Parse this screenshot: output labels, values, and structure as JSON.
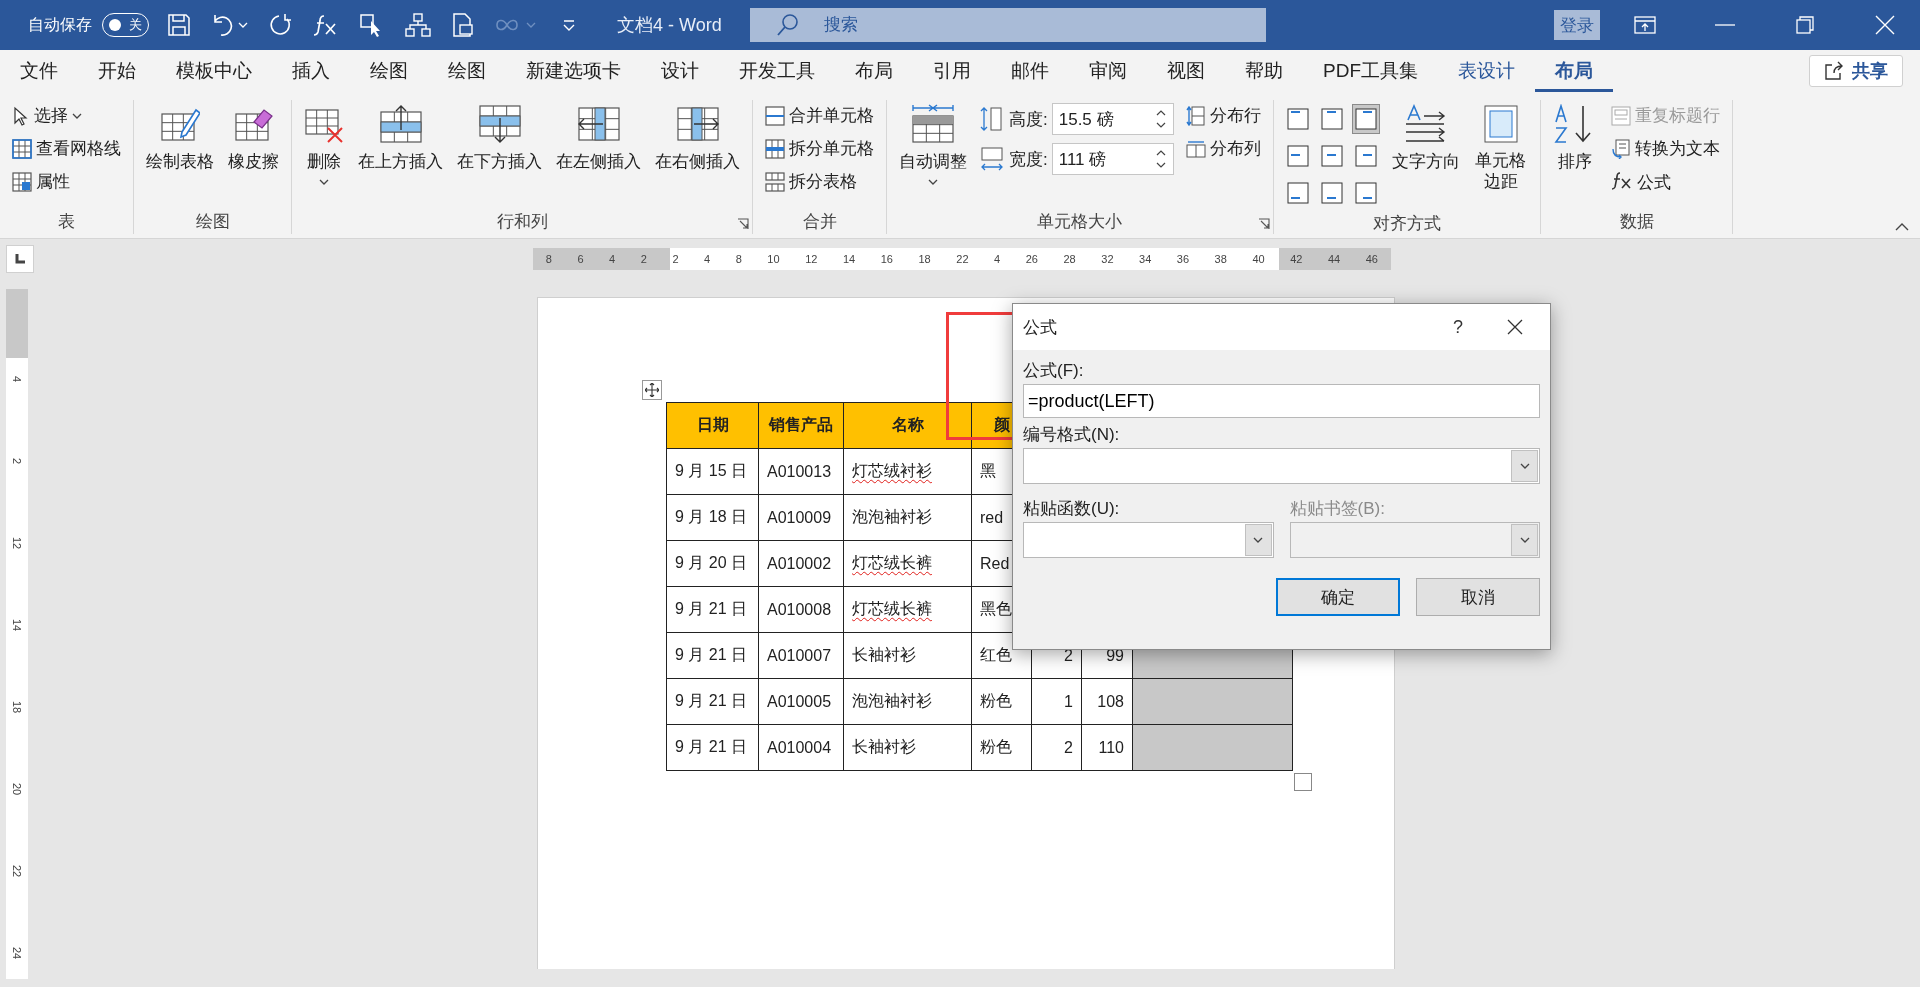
{
  "title_bar": {
    "autosave": {
      "label": "自动保存",
      "on": false,
      "state_label": "关"
    },
    "title": "文档4 - Word",
    "search": {
      "placeholder": "搜索"
    },
    "login": "登录"
  },
  "menu_tabs": [
    {
      "label": "文件",
      "selected": false,
      "contextual": false
    },
    {
      "label": "开始",
      "selected": false,
      "contextual": false
    },
    {
      "label": "模板中心",
      "selected": false,
      "contextual": false
    },
    {
      "label": "插入",
      "selected": false,
      "contextual": false
    },
    {
      "label": "绘图",
      "selected": false,
      "contextual": false
    },
    {
      "label": "绘图",
      "selected": false,
      "contextual": false
    },
    {
      "label": "新建选项卡",
      "selected": false,
      "contextual": false
    },
    {
      "label": "设计",
      "selected": false,
      "contextual": false
    },
    {
      "label": "开发工具",
      "selected": false,
      "contextual": false
    },
    {
      "label": "布局",
      "selected": false,
      "contextual": false
    },
    {
      "label": "引用",
      "selected": false,
      "contextual": false
    },
    {
      "label": "邮件",
      "selected": false,
      "contextual": false
    },
    {
      "label": "审阅",
      "selected": false,
      "contextual": false
    },
    {
      "label": "视图",
      "selected": false,
      "contextual": false
    },
    {
      "label": "帮助",
      "selected": false,
      "contextual": false
    },
    {
      "label": "PDF工具集",
      "selected": false,
      "contextual": false
    },
    {
      "label": "表设计",
      "selected": false,
      "contextual": true
    },
    {
      "label": "布局",
      "selected": true,
      "contextual": true
    }
  ],
  "share": "共享",
  "ribbon": [
    {
      "label": "表",
      "items": [
        {
          "kind": "small",
          "label": "选择",
          "caret": true
        },
        {
          "kind": "small",
          "label": "查看网格线"
        },
        {
          "kind": "small",
          "label": "属性"
        }
      ]
    },
    {
      "label": "绘图",
      "items": [
        {
          "kind": "large",
          "label": "绘制表格"
        },
        {
          "kind": "large",
          "label": "橡皮擦"
        }
      ]
    },
    {
      "label": "行和列",
      "launcher": true,
      "items": [
        {
          "kind": "large",
          "label": "删除",
          "caret": true
        },
        {
          "kind": "large",
          "label": "在上方插入"
        },
        {
          "kind": "large",
          "label": "在下方插入"
        },
        {
          "kind": "large",
          "label": "在左侧插入"
        },
        {
          "kind": "large",
          "label": "在右侧插入"
        }
      ]
    },
    {
      "label": "合并",
      "items": [
        {
          "kind": "small",
          "label": "合并单元格"
        },
        {
          "kind": "small",
          "label": "拆分单元格"
        },
        {
          "kind": "small",
          "label": "拆分表格"
        }
      ]
    },
    {
      "label": "单元格大小",
      "launcher": true,
      "items": [
        {
          "kind": "large",
          "label": "自动调整",
          "caret": true
        },
        {
          "kind": "spin",
          "label": "高度:",
          "value": "15.5 磅"
        },
        {
          "kind": "spin",
          "label": "宽度:",
          "value": "111 磅"
        },
        {
          "kind": "small",
          "label": "分布行"
        },
        {
          "kind": "small",
          "label": "分布列"
        }
      ]
    },
    {
      "label": "对齐方式",
      "items": [
        {
          "kind": "align_grid",
          "cells": [
            {
              "selected": false
            },
            {
              "selected": false
            },
            {
              "selected": true
            },
            {
              "selected": false
            },
            {
              "selected": false
            },
            {
              "selected": false
            },
            {
              "selected": false
            },
            {
              "selected": false
            },
            {
              "selected": false
            }
          ]
        },
        {
          "kind": "large",
          "label": "文字方向"
        },
        {
          "kind": "large",
          "label": "单元格边距"
        }
      ]
    },
    {
      "label": "数据",
      "items": [
        {
          "kind": "large",
          "label": "排序"
        },
        {
          "kind": "small",
          "label": "重复标题行",
          "disabled": true
        },
        {
          "kind": "small",
          "label": "转换为文本",
          "disabled": false
        },
        {
          "kind": "small",
          "label": "公式",
          "disabled": false
        }
      ]
    }
  ],
  "ruler": {
    "horizontal": [
      "8",
      "6",
      "4",
      "2",
      "2",
      "4",
      "8",
      "10",
      "12",
      "14",
      "16",
      "18",
      "22",
      "4",
      "26",
      "28",
      "32",
      "34",
      "36",
      "38",
      "40",
      "42",
      "44",
      "46"
    ],
    "vertical": [
      "4",
      "2",
      "12",
      "14",
      "18",
      "20",
      "22",
      "24"
    ]
  },
  "table": {
    "columns": [
      "日期",
      "销售产品",
      "名称",
      "颜"
    ],
    "rows": [
      {
        "cells": [
          "9 月 15 日",
          "A010013",
          "灯芯绒衬衫",
          "黑"
        ],
        "misspelled": true
      },
      {
        "cells": [
          "9 月 18 日",
          "A010009",
          "泡泡袖衬衫",
          "red"
        ],
        "misspelled": false
      },
      {
        "cells": [
          "9 月 20 日",
          "A010002",
          "灯芯绒长裤",
          "Red"
        ],
        "misspelled": true
      },
      {
        "cells": [
          "9 月 21 日",
          "A010008",
          "灯芯绒长裤",
          "黑色"
        ],
        "misspelled": true
      },
      {
        "cells": [
          "9 月 21 日",
          "A010007",
          "长袖衬衫",
          "红色",
          "2",
          "99"
        ],
        "misspelled": false,
        "selected": true
      },
      {
        "cells": [
          "9 月 21 日",
          "A010005",
          "泡泡袖衬衫",
          "粉色",
          "1",
          "108"
        ],
        "misspelled": false,
        "selected": true
      },
      {
        "cells": [
          "9 月 21 日",
          "A010004",
          "长袖衬衫",
          "粉色",
          "2",
          "110"
        ],
        "misspelled": false,
        "selected": true
      }
    ]
  },
  "dialog": {
    "title": "公式",
    "help": "?",
    "formula": {
      "label": "公式(F):",
      "value": "=product(LEFT)"
    },
    "number_format": {
      "label": "编号格式(N):"
    },
    "paste_function": {
      "label": "粘贴函数(U):"
    },
    "paste_bookmark": {
      "label": "粘贴书签(B):",
      "disabled": true
    },
    "buttons": [
      {
        "label": "确定",
        "default": true
      },
      {
        "label": "取消",
        "default": false
      }
    ]
  }
}
